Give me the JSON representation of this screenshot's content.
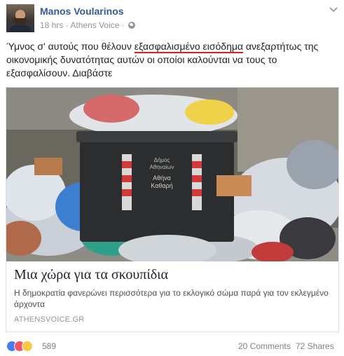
{
  "post": {
    "author": "Manos Voularinos",
    "time": "18 hrs",
    "source": "Athens Voice",
    "separator": "·",
    "text_before": "Ύμνος σ' αυτούς που θέλουν ",
    "text_highlight": "εξασφαλισμένο εισόδημα",
    "text_after": " ανεξαρτήτως της οικονομικής δυνατότητας αυτών οι οποίοι καλούνται να τους το εξασφαλίσουν. Διαβάστε"
  },
  "link": {
    "title": "Μια χώρα για τα σκουπίδια",
    "description": "Η δημοκρατία φανερώνει περισσότερα για το εκλογικό σώμα παρά για τον εκλεγμένο άρχοντα",
    "domain": "ATHENSVOICE.GR",
    "image_bin_text_1": "Δήμος",
    "image_bin_text_2": "Αθηναίων",
    "image_bin_text_3": "Αθήνα",
    "image_bin_text_4": "Καθαρή"
  },
  "footer": {
    "reaction_count": "589",
    "comments": "20 Comments",
    "shares": "72 Shares"
  },
  "icons": {
    "avatar": "profile-photo",
    "globe": "globe-icon",
    "chevron": "chevron-down-icon",
    "like": "like-reaction-icon",
    "love": "love-reaction-icon",
    "haha": "haha-reaction-icon"
  },
  "colors": {
    "author": "#365899",
    "meta": "#90949c",
    "highlight_underline": "#e02020",
    "like": "#4a7af2",
    "love": "#f25268",
    "haha": "#f7c945"
  }
}
